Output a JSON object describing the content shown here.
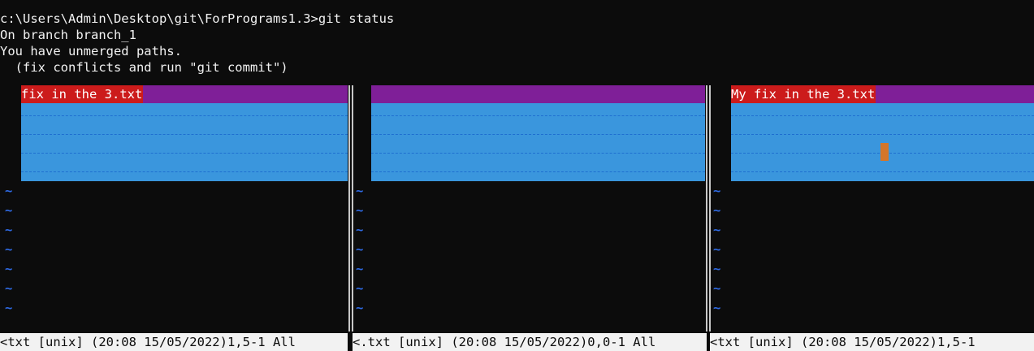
{
  "terminal": {
    "lines": [
      "c:\\Users\\Admin\\Desktop\\git\\ForPrograms1.3>git status",
      "On branch branch_1",
      "You have unmerged paths.",
      "  (fix conflicts and run \"git commit\")"
    ]
  },
  "panes": {
    "left": {
      "header_text": "fix in the 3.txt",
      "status": "<txt [unix] (20:08 15/05/2022)1,5-1 All"
    },
    "middle": {
      "header_text": "",
      "status": "<.txt [unix] (20:08 15/05/2022)0,0-1 All"
    },
    "right": {
      "header_text": "My fix in the 3.txt",
      "status": "<txt [unix] (20:08 15/05/2022)1,5-1"
    }
  },
  "tilde_char": "~",
  "colors": {
    "background": "#0c0c0c",
    "header_bar": "#7f1f98",
    "header_text_bg": "#cc1b1b",
    "diff_block": "#3a96dd",
    "tilde": "#2f6be6",
    "cursor": "#d3762a",
    "status_bar": "#f2f2f2"
  }
}
